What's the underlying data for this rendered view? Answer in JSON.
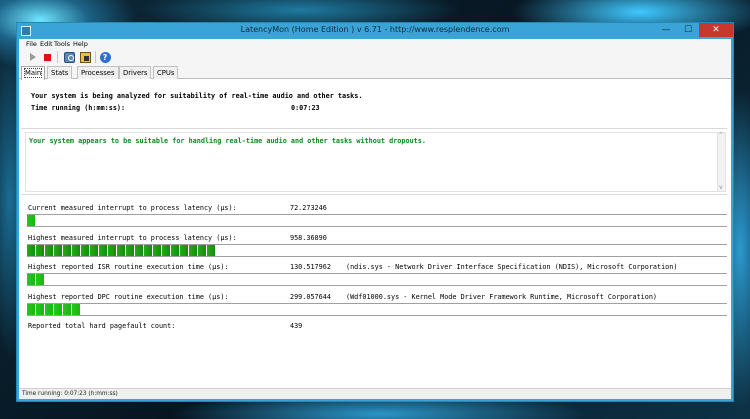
{
  "window": {
    "title": "LatencyMon  (Home Edition )  v 6.71 - http://www.resplendence.com",
    "controls": {
      "minimize": "—",
      "maximize": "☐",
      "close": "✕"
    }
  },
  "menu": [
    "File",
    "Edit",
    "Tools",
    "Help"
  ],
  "toolbar": {
    "buttons": [
      "play-icon",
      "stop-icon",
      "search-icon",
      "drivers-icon",
      "help-icon"
    ],
    "help_glyph": "?"
  },
  "tabs": [
    "Main",
    "Stats",
    "Processes",
    "Drivers",
    "CPUs"
  ],
  "active_tab": "Main",
  "main": {
    "analyzing_text": "Your system is being analyzed for suitability of real-time audio and other tasks.",
    "time_running_label": "Time running (h:mm:ss):",
    "time_running_value": "0:07:23",
    "result_text": "Your system appears to be suitable for handling real-time audio and other tasks without dropouts.",
    "result_color": "#0b8a1c",
    "metrics": [
      {
        "label": "Current measured interrupt to process latency (µs):",
        "value": "72.273246",
        "desc": "",
        "bar_fraction": 0.013,
        "has_bar": true
      },
      {
        "label": "Highest measured interrupt to process latency (µs):",
        "value": "958.36890",
        "desc": "",
        "bar_fraction": 0.27,
        "has_bar": true
      },
      {
        "label": "Highest reported ISR routine execution time (µs):",
        "value": "130.517962",
        "desc": "(ndis.sys - Network Driver Interface Specification (NDIS), Microsoft Corporation)",
        "bar_fraction": 0.025,
        "has_bar": true
      },
      {
        "label": "Highest reported DPC routine execution time (µs):",
        "value": "299.057644",
        "desc": "(Wdf01000.sys - Kernel Mode Driver Framework Runtime, Microsoft Corporation)",
        "bar_fraction": 0.077,
        "has_bar": true
      },
      {
        "label": "Reported total hard pagefault count:",
        "value": "439",
        "desc": "",
        "bar_fraction": 0,
        "has_bar": false
      }
    ]
  },
  "status_bar": "Time running: 0:07:23  (h:mm:ss)"
}
